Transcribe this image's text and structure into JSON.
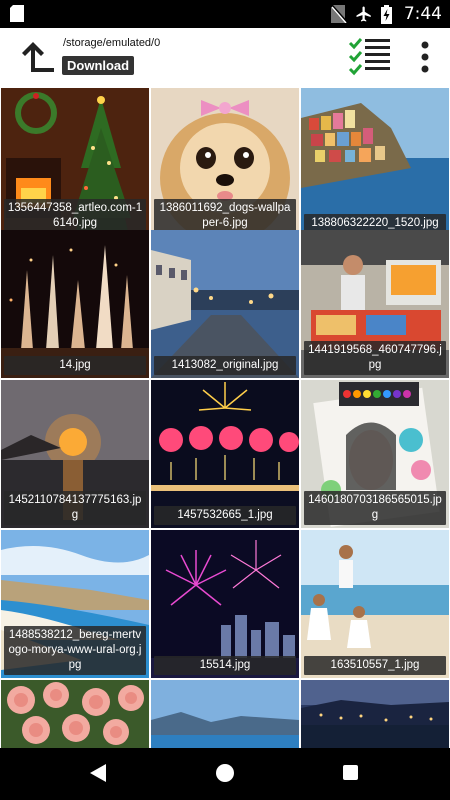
{
  "status": {
    "time": "7:44"
  },
  "toolbar": {
    "path": "/storage/emulated/0",
    "folder": "Download"
  },
  "images": [
    {
      "caption": "1356447358_artleo.com-16140.jpg"
    },
    {
      "caption": "1386011692_dogs-wallpaper-6.jpg"
    },
    {
      "caption": "138806322220_1520.jpg"
    },
    {
      "caption": "14.jpg"
    },
    {
      "caption": "1413082_original.jpg"
    },
    {
      "caption": "1441919568_460747796.jpg"
    },
    {
      "caption": "1452110784137775163.jpg"
    },
    {
      "caption": "1457532665_1.jpg"
    },
    {
      "caption": "1460180703186565015.jpg"
    },
    {
      "caption": "1488538212_bereg-mertvogo-morya-www-ural-org.jpg"
    },
    {
      "caption": "15514.jpg"
    },
    {
      "caption": "163510557_1.jpg"
    },
    {
      "caption": ""
    },
    {
      "caption": ""
    },
    {
      "caption": ""
    }
  ]
}
